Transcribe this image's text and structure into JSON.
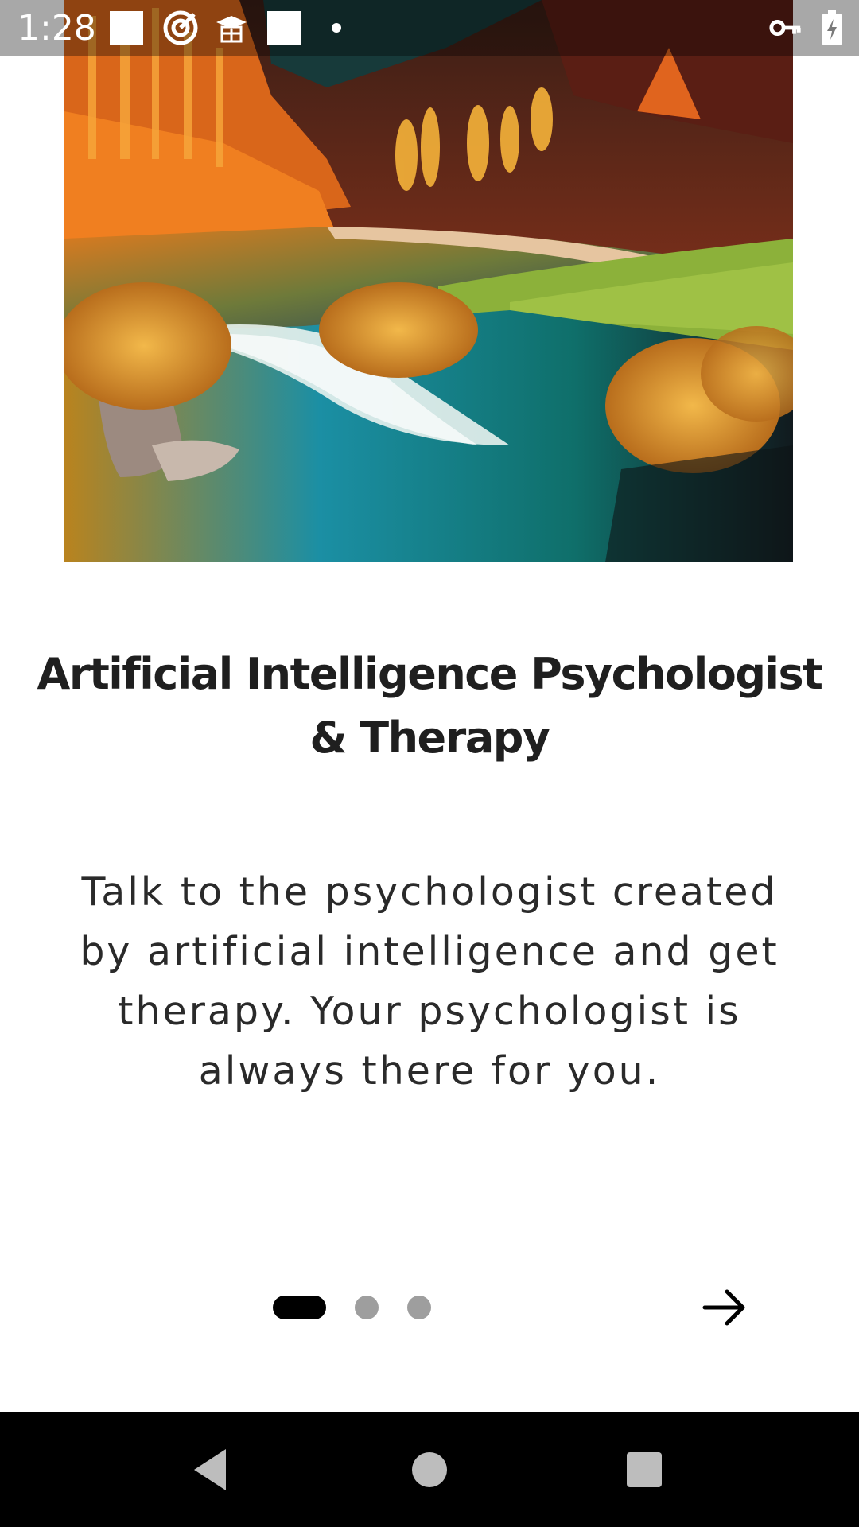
{
  "status_bar": {
    "time": "1:28",
    "icons": [
      "white-square-icon",
      "target-icon",
      "graduation-cap-icon",
      "white-square-icon",
      "notification-dot-icon",
      "vpn-key-icon",
      "battery-charging-icon"
    ]
  },
  "hero": {
    "image": "landscape-river-autumn-image"
  },
  "onboarding": {
    "title": "Artificial Intelligence Psychologist & Therapy",
    "description": "Talk to the psychologist created by artificial intelligence and get therapy. Your psychologist is always there for you.",
    "page_count": 3,
    "current_page": 1
  },
  "colors": {
    "indicator_active": "#000000",
    "indicator_inactive": "#9e9e9e",
    "nav_bar": "#000000"
  },
  "nav_bar": {
    "buttons": [
      "back-icon",
      "home-icon",
      "recents-icon"
    ]
  }
}
